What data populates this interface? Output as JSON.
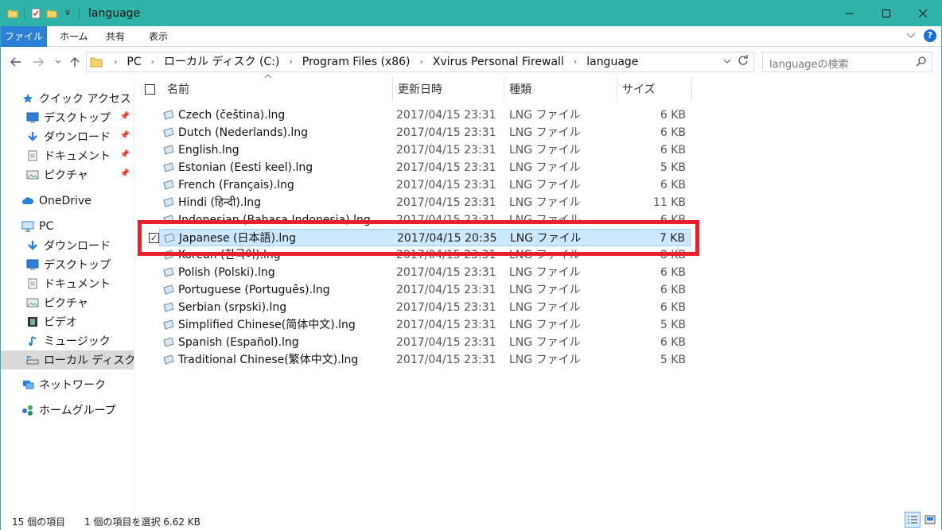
{
  "window": {
    "title": "language"
  },
  "ribbon": {
    "tabs": [
      "ファイル",
      "ホーム",
      "共有",
      "表示"
    ]
  },
  "address": {
    "crumbs": [
      "PC",
      "ローカル ディスク (C:)",
      "Program Files (x86)",
      "Xvirus Personal Firewall",
      "language"
    ]
  },
  "search": {
    "placeholder": "languageの検索"
  },
  "sidebar": {
    "quick_access": "クイック アクセス",
    "quick_items": [
      "デスクトップ",
      "ダウンロード",
      "ドキュメント",
      "ピクチャ"
    ],
    "onedrive": "OneDrive",
    "pc": "PC",
    "pc_items": [
      "ダウンロード",
      "デスクトップ",
      "ドキュメント",
      "ピクチャ",
      "ビデオ",
      "ミュージック",
      "ローカル ディスク"
    ],
    "network": "ネットワーク",
    "homegroup": "ホームグループ"
  },
  "columns": {
    "name": "名前",
    "date": "更新日時",
    "type": "種類",
    "size": "サイズ"
  },
  "files": [
    {
      "name": "Czech (čeština).lng",
      "date": "2017/04/15 23:31",
      "type": "LNG ファイル",
      "size": "6 KB"
    },
    {
      "name": "Dutch (Nederlands).lng",
      "date": "2017/04/15 23:31",
      "type": "LNG ファイル",
      "size": "6 KB"
    },
    {
      "name": "English.lng",
      "date": "2017/04/15 23:31",
      "type": "LNG ファイル",
      "size": "6 KB"
    },
    {
      "name": "Estonian (Eesti keel).lng",
      "date": "2017/04/15 23:31",
      "type": "LNG ファイル",
      "size": "5 KB"
    },
    {
      "name": "French (Français).lng",
      "date": "2017/04/15 23:31",
      "type": "LNG ファイル",
      "size": "6 KB"
    },
    {
      "name": "Hindi (हिन्दी).lng",
      "date": "2017/04/15 23:31",
      "type": "LNG ファイル",
      "size": "11 KB"
    },
    {
      "name": "Indonesian (Bahasa Indonesia).lng",
      "date": "2017/04/15 23:31",
      "type": "LNG ファイル",
      "size": "6 KB"
    },
    {
      "name": "Japanese (日本語).lng",
      "date": "2017/04/15 20:35",
      "type": "LNG ファイル",
      "size": "7 KB"
    },
    {
      "name": "Korean (한국어).lng",
      "date": "2017/04/15 23:31",
      "type": "LNG ファイル",
      "size": "8 KB"
    },
    {
      "name": "Polish (Polski).lng",
      "date": "2017/04/15 23:31",
      "type": "LNG ファイル",
      "size": "6 KB"
    },
    {
      "name": "Portuguese (Português).lng",
      "date": "2017/04/15 23:31",
      "type": "LNG ファイル",
      "size": "6 KB"
    },
    {
      "name": "Serbian (srpski).lng",
      "date": "2017/04/15 23:31",
      "type": "LNG ファイル",
      "size": "6 KB"
    },
    {
      "name": "Simplified Chinese(简体中文).lng",
      "date": "2017/04/15 23:31",
      "type": "LNG ファイル",
      "size": "5 KB"
    },
    {
      "name": "Spanish (Español).lng",
      "date": "2017/04/15 23:31",
      "type": "LNG ファイル",
      "size": "6 KB"
    },
    {
      "name": "Traditional Chinese(繁体中文).lng",
      "date": "2017/04/15 23:31",
      "type": "LNG ファイル",
      "size": "5 KB"
    }
  ],
  "status": {
    "count": "15 個の項目",
    "selection": "1 個の項目を選択  6.62 KB"
  },
  "colors": {
    "titlebar": "#2fb3a8",
    "file_tab": "#2a7fd6",
    "selection": "#cce8ff",
    "highlight": "#e8202a"
  }
}
